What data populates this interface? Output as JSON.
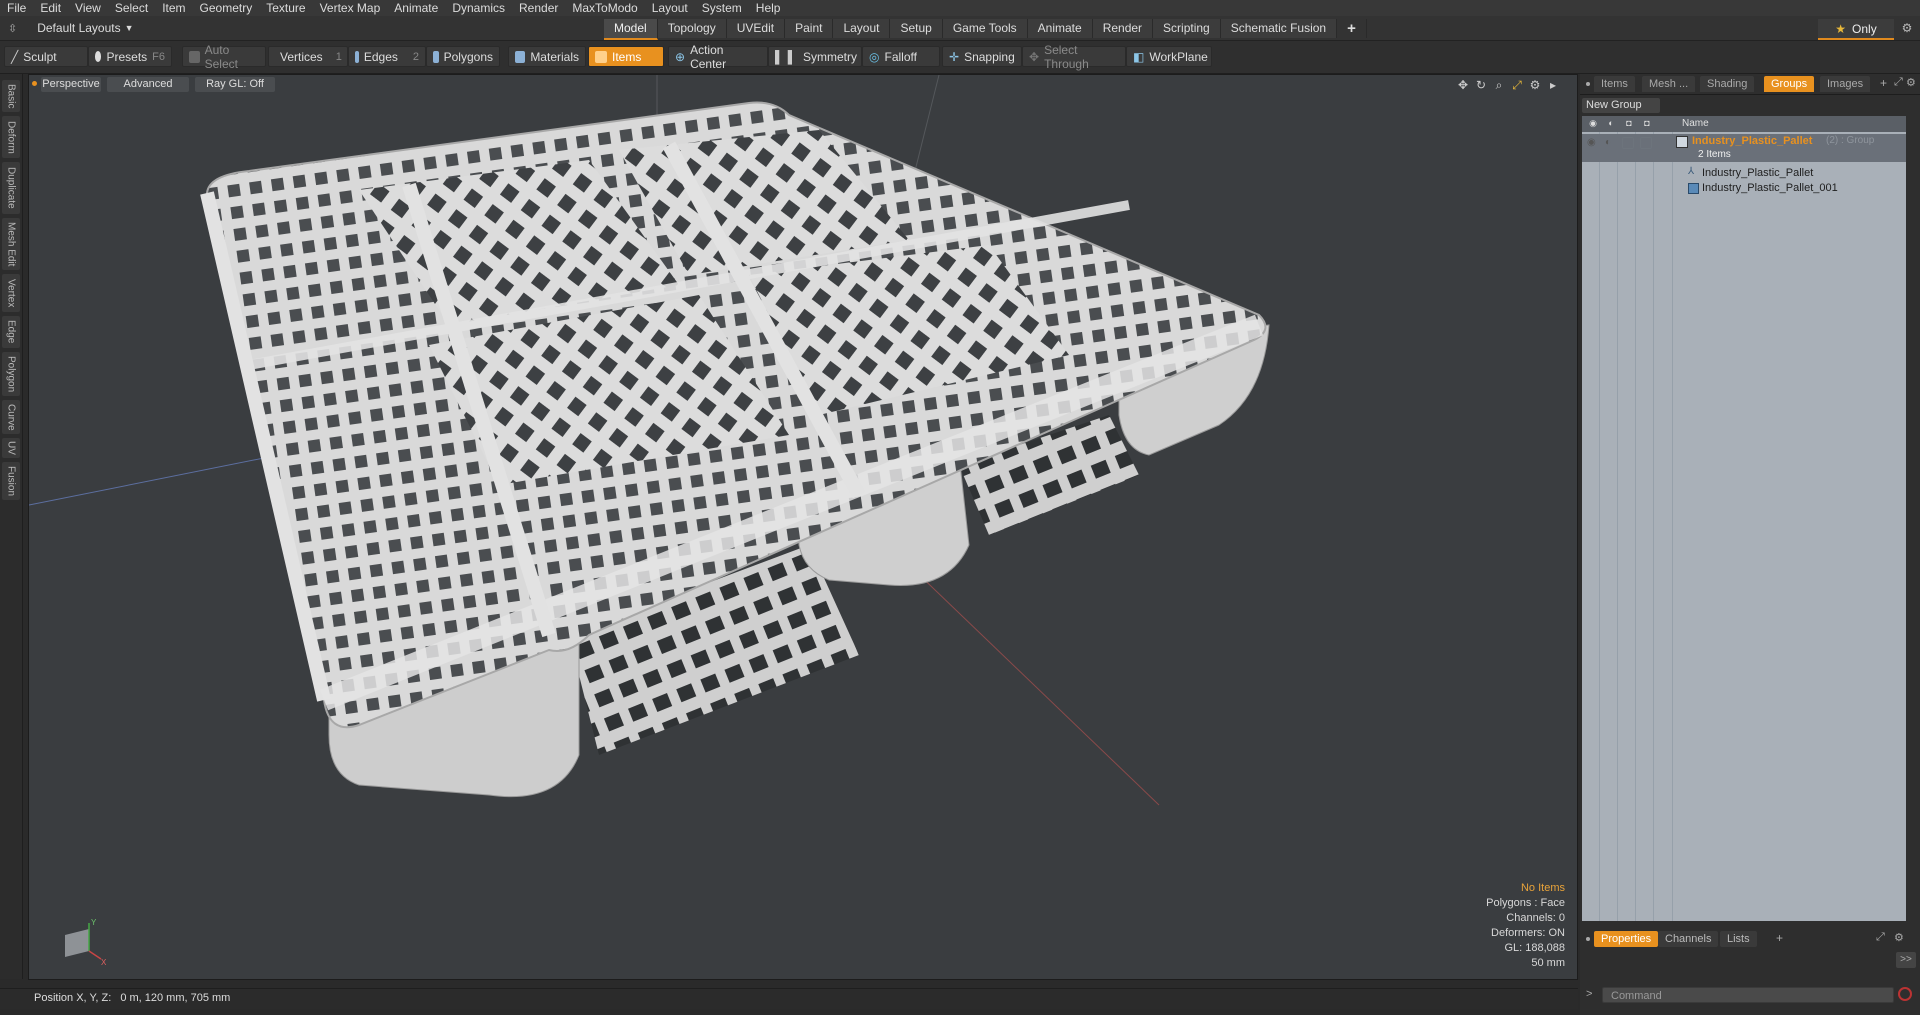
{
  "menubar": {
    "items": [
      "File",
      "Edit",
      "View",
      "Select",
      "Item",
      "Geometry",
      "Texture",
      "Vertex Map",
      "Animate",
      "Dynamics",
      "Render",
      "MaxToModo",
      "Layout",
      "System",
      "Help"
    ]
  },
  "layoutbar": {
    "layout_label": "Default Layouts",
    "tabs": [
      "Model",
      "Topology",
      "UVEdit",
      "Paint",
      "Layout",
      "Setup",
      "Game Tools",
      "Animate",
      "Render",
      "Scripting",
      "Schematic Fusion"
    ],
    "active_tab": "Model",
    "add_tab": "+",
    "only_label": "Only"
  },
  "toolbar": {
    "sculpt": "Sculpt",
    "presets": "Presets",
    "presets_key": "F6",
    "auto_select": "Auto Select",
    "vertices": "Vertices",
    "vertices_key": "1",
    "edges": "Edges",
    "edges_key": "2",
    "polygons": "Polygons",
    "materials": "Materials",
    "items": "Items",
    "action_center": "Action Center",
    "symmetry": "Symmetry",
    "falloff": "Falloff",
    "snapping": "Snapping",
    "select_through": "Select Through",
    "workplane": "WorkPlane"
  },
  "lefttabs": [
    "Basic",
    "Deform",
    "Duplicate",
    "Mesh Edit",
    "Vertex",
    "Edge",
    "Polygon",
    "Curve",
    "UV",
    "Fusion"
  ],
  "viewport": {
    "view": "Perspective",
    "advanced": "Advanced",
    "raygl": "Ray GL: Off",
    "hud": {
      "no_items": "No Items",
      "polygons": "Polygons : Face",
      "channels": "Channels: 0",
      "deformers": "Deformers: ON",
      "gl": "GL: 188,088",
      "unit": "50 mm"
    },
    "axis_labels": {
      "y": "Y",
      "x": "X",
      "z": "Z"
    }
  },
  "statusbar": {
    "position_label": "Position X, Y, Z:",
    "position_value": "0 m, 120 mm, 705 mm"
  },
  "rightpanel": {
    "tabs": [
      "Items",
      "Mesh ...",
      "Shading",
      "Groups",
      "Images"
    ],
    "active_tab": "Groups",
    "new_group": "New Group",
    "name_header": "Name",
    "rows": [
      {
        "name": "Industry_Plastic_Pallet",
        "suffix": "(2) : Group",
        "sub": "2 Items"
      },
      {
        "name": "Industry_Plastic_Pallet"
      },
      {
        "name": "Industry_Plastic_Pallet_001"
      }
    ],
    "bottom_tabs": [
      "Properties",
      "Channels",
      "Lists"
    ],
    "bottom_active": "Properties",
    "command_placeholder": "Command",
    "expand_label": ">>"
  },
  "colors": {
    "accent": "#e8911f",
    "viewport": "#3a3d40",
    "group_text": "#e8911f"
  }
}
